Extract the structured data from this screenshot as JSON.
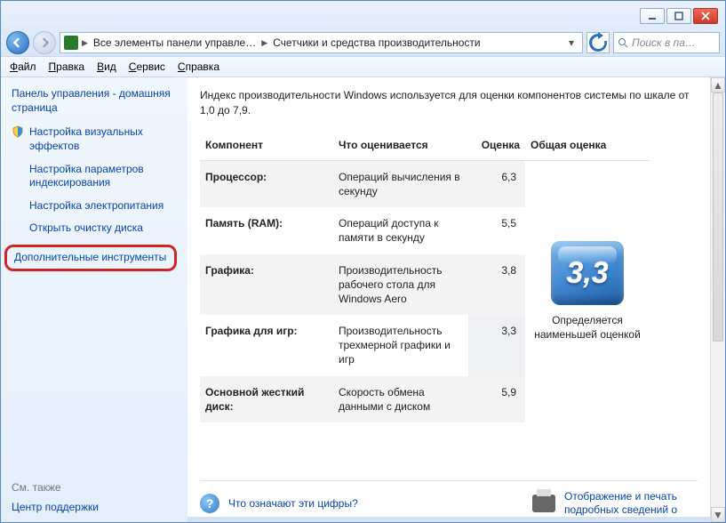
{
  "titlebar": {},
  "breadcrumbs": {
    "cp": "Все элементы панели управле…",
    "page": "Счетчики и средства производительности"
  },
  "search": {
    "placeholder": "Поиск в па…"
  },
  "menu": {
    "file": "Файл",
    "edit": "Правка",
    "view": "Вид",
    "tools": "Сервис",
    "help": "Справка"
  },
  "sidebar": {
    "home": "Панель управления - домашняя страница",
    "links": {
      "visual": "Настройка визуальных эффектов",
      "indexing": "Настройка параметров индексирования",
      "power": "Настройка электропитания",
      "diskcleanup": "Открыть очистку диска",
      "advanced": "Дополнительные инструменты"
    },
    "see_also": "См. также",
    "support": "Центр поддержки"
  },
  "main": {
    "intro": "Индекс производительности Windows используется для оценки компонентов системы по шкале от 1,0 до 7,9.",
    "headers": {
      "component": "Компонент",
      "what": "Что оценивается",
      "score": "Оценка",
      "base": "Общая оценка"
    },
    "rows": [
      {
        "component": "Процессор:",
        "what": "Операций вычисления в секунду",
        "score": "6,3"
      },
      {
        "component": "Память (RAM):",
        "what": "Операций доступа к памяти в секунду",
        "score": "5,5"
      },
      {
        "component": "Графика:",
        "what": "Производительность рабочего стола для Windows Aero",
        "score": "3,8"
      },
      {
        "component": "Графика для игр:",
        "what": "Производительность трехмерной графики и игр",
        "score": "3,3"
      },
      {
        "component": "Основной жесткий диск:",
        "what": "Скорость обмена данными с диском",
        "score": "5,9"
      }
    ],
    "base_score": "3,3",
    "base_caption": "Определяется наименьшей оценкой",
    "footer": {
      "what_numbers": "Что означают эти цифры?",
      "print": "Отображение и печать подробных сведений о"
    }
  },
  "chart_data": {
    "type": "table",
    "title": "Индекс производительности Windows",
    "ylim": [
      1.0,
      7.9
    ],
    "categories": [
      "Процессор",
      "Память (RAM)",
      "Графика",
      "Графика для игр",
      "Основной жесткий диск"
    ],
    "values": [
      6.3,
      5.5,
      3.8,
      3.3,
      5.9
    ],
    "base_score": 3.3
  }
}
